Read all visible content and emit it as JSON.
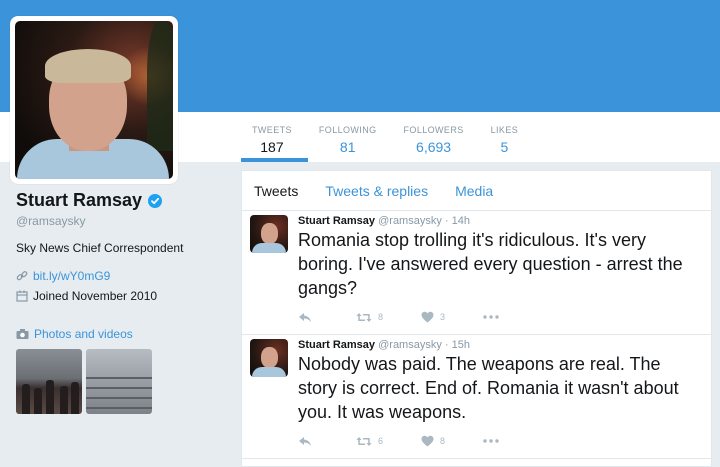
{
  "profile": {
    "name": "Stuart Ramsay",
    "handle": "@ramsaysky",
    "bio": "Sky News Chief Correspondent",
    "link": "bit.ly/wY0mG9",
    "joined": "Joined November 2010",
    "photos_label": "Photos and videos"
  },
  "stats": [
    {
      "label": "TWEETS",
      "value": "187"
    },
    {
      "label": "FOLLOWING",
      "value": "81"
    },
    {
      "label": "FOLLOWERS",
      "value": "6,693"
    },
    {
      "label": "LIKES",
      "value": "5"
    }
  ],
  "tabs": [
    {
      "label": "Tweets"
    },
    {
      "label": "Tweets & replies"
    },
    {
      "label": "Media"
    }
  ],
  "tweets": [
    {
      "name": "Stuart Ramsay",
      "handle": "@ramsaysky",
      "time": "· 14h",
      "text": "Romania stop trolling it's ridiculous. It's very boring. I've answered every question - arrest the gangs?",
      "retweets": "8",
      "likes": "3"
    },
    {
      "name": "Stuart Ramsay",
      "handle": "@ramsaysky",
      "time": "· 15h",
      "text": "Nobody was paid. The weapons are real. The story is correct. End of. Romania it wasn't about you. It was weapons.",
      "retweets": "6",
      "likes": "8"
    }
  ],
  "colors": {
    "accent": "#3b94d9",
    "banner": "#3b94d9",
    "muted": "#8899a6",
    "verified": "#1da1f2"
  },
  "icons": [
    "verified-badge-icon",
    "link-icon",
    "calendar-icon",
    "camera-icon",
    "reply-icon",
    "retweet-icon",
    "like-icon",
    "more-icon"
  ]
}
